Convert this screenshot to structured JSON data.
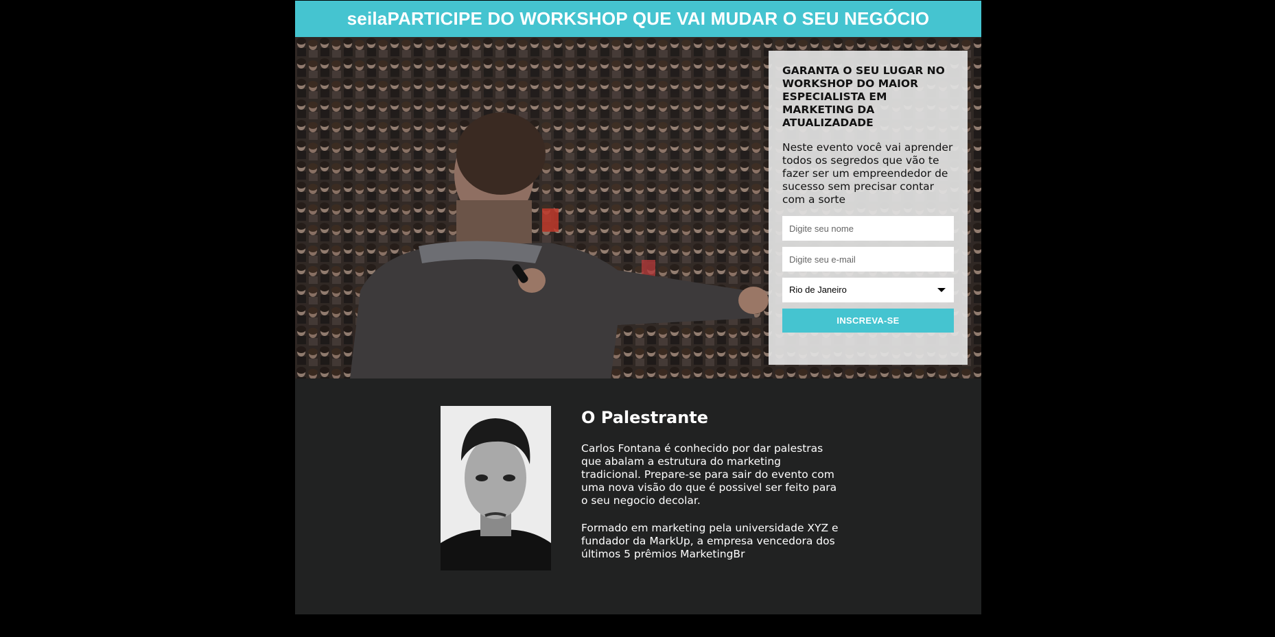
{
  "banner": {
    "title": "seilaPARTICIPE DO WORKSHOP QUE VAI MUDAR O SEU NEGÓCIO"
  },
  "form": {
    "heading": "GARANTA O SEU LUGAR NO WORKSHOP DO MAIOR ESPECIALISTA EM MARKETING DA ATUALIZADADE",
    "description": "Neste evento você vai aprender todos os segredos que vão te fazer ser um empreendedor de sucesso sem precisar contar com a sorte",
    "name_placeholder": "Digite seu nome",
    "email_placeholder": "Digite seu e-mail",
    "city_selected": "Rio de Janeiro",
    "submit_label": "INSCREVA-SE"
  },
  "speaker": {
    "title": "O Palestrante",
    "paragraph1": "Carlos Fontana é conhecido por dar palestras que abalam a estrutura do marketing tradicional. Prepare-se para sair do evento com uma nova visão do que é possivel ser feito para o seu negocio decolar.",
    "paragraph2": "Formado em marketing pela universidade XYZ e fundador da MarkUp, a empresa vencedora dos últimos 5 prêmios MarketingBr"
  },
  "colors": {
    "accent": "#45c4d0",
    "section_background": "#212222",
    "page_background": "#000000"
  }
}
